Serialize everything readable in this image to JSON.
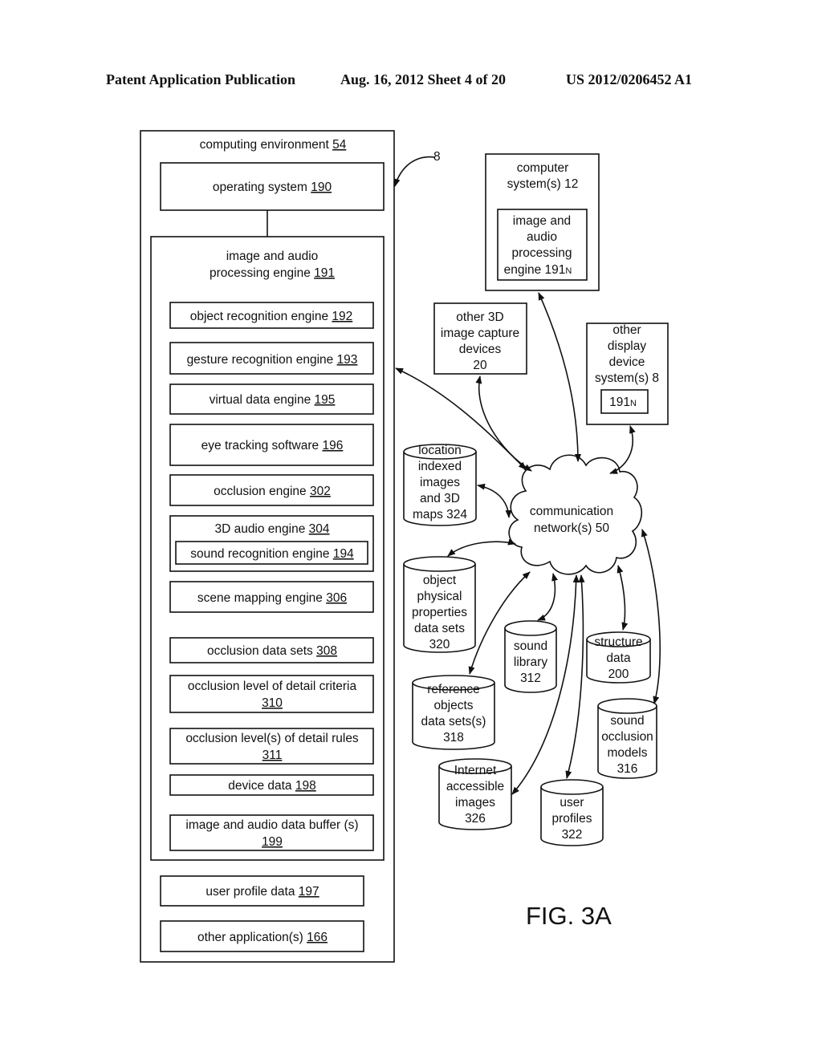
{
  "header": {
    "left": "Patent Application Publication",
    "middle": "Aug. 16, 2012  Sheet 4 of 20",
    "right": "US 2012/0206452 A1"
  },
  "reference_label": "8",
  "computing_environment": {
    "title": "computing environment",
    "ref": "54",
    "operating_system": {
      "label": "operating system",
      "ref": "190"
    },
    "engine": {
      "title_line1": "image and audio",
      "title_line2": "processing engine",
      "ref": "191",
      "modules": [
        {
          "label": "object recognition engine",
          "ref": "192"
        },
        {
          "label": "gesture recognition engine",
          "ref": "193"
        },
        {
          "label": "virtual data engine",
          "ref": "195"
        },
        {
          "label": "eye tracking software",
          "ref": "196"
        },
        {
          "label": "occlusion engine",
          "ref": "302"
        },
        {
          "label": "3D audio engine",
          "ref": "304",
          "sub": {
            "label": "sound recognition engine",
            "ref": "194"
          }
        },
        {
          "label": "scene mapping engine",
          "ref": "306"
        },
        {
          "label": "occlusion data sets",
          "ref": "308"
        },
        {
          "label": "occlusion level of detail criteria",
          "ref": "310"
        },
        {
          "label": "occlusion level(s) of detail rules",
          "ref": "311"
        },
        {
          "label": "device data",
          "ref": "198"
        },
        {
          "label": "image and audio data buffer (s)",
          "ref": "199"
        }
      ]
    },
    "user_profile_data": {
      "label": "user profile data",
      "ref": "197"
    },
    "other_applications": {
      "label": "other application(s)",
      "ref": "166"
    }
  },
  "computer_systems": {
    "lines": [
      "computer",
      "system(s) 12"
    ],
    "inner": [
      "image and",
      "audio",
      "processing",
      "engine 191"
    ],
    "inner_subscript": "N"
  },
  "capture_devices": {
    "lines": [
      "other 3D",
      "image capture",
      "devices",
      "20"
    ]
  },
  "display_systems": {
    "lines": [
      "other",
      "display",
      "device",
      "system(s) 8"
    ],
    "inner": "191",
    "inner_subscript": "N"
  },
  "network": {
    "lines": [
      "communication",
      "network(s) 50"
    ]
  },
  "databases": {
    "location_images": [
      "location",
      "indexed",
      "images",
      "and 3D",
      "maps 324"
    ],
    "object_physical": [
      "object",
      "physical",
      "properties",
      "data sets",
      "320"
    ],
    "sound_library": [
      "sound",
      "library",
      "312"
    ],
    "structure_data": [
      "structure",
      "data",
      "200"
    ],
    "reference_objects": [
      "reference",
      "objects",
      "data sets(s)",
      "318"
    ],
    "sound_occlusion": [
      "sound",
      "occlusion",
      "models",
      "316"
    ],
    "internet_images": [
      "Internet",
      "accessible",
      "images",
      "326"
    ],
    "user_profiles": [
      "user",
      "profiles",
      "322"
    ]
  },
  "figure_label": "FIG. 3A"
}
